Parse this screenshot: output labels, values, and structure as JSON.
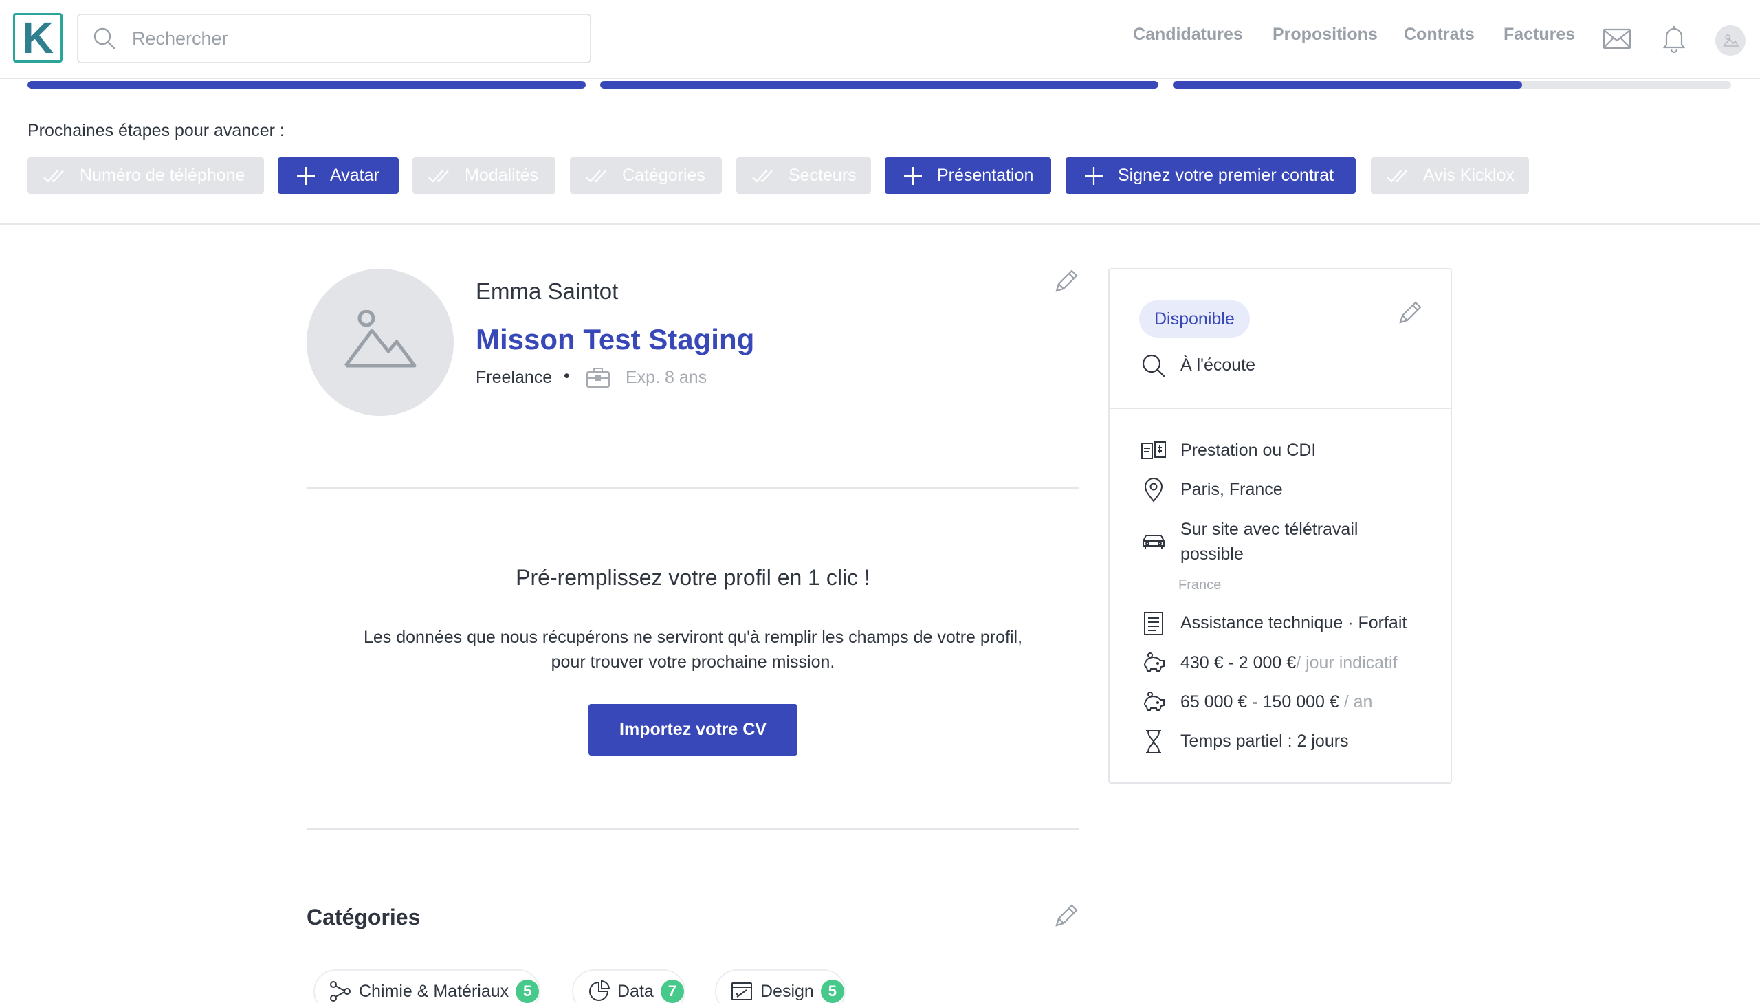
{
  "header": {
    "logo_letter": "K",
    "search_placeholder": "Rechercher",
    "nav": [
      "Candidatures",
      "Propositions",
      "Contrats",
      "Factures"
    ],
    "icons": [
      "envelope-icon",
      "bell-icon",
      "avatar-icon"
    ]
  },
  "progress": [
    1.0,
    1.0,
    0.625
  ],
  "steps": {
    "title": "Prochaines étapes pour avancer :",
    "items": [
      {
        "label": "Numéro de téléphone",
        "state": "done"
      },
      {
        "label": "Avatar",
        "state": "todo"
      },
      {
        "label": "Modalités",
        "state": "done"
      },
      {
        "label": "Catégories",
        "state": "done"
      },
      {
        "label": "Secteurs",
        "state": "done"
      },
      {
        "label": "Présentation",
        "state": "todo"
      },
      {
        "label": "Signez votre premier contrat",
        "state": "todo"
      },
      {
        "label": "Avis Kicklox",
        "state": "done"
      }
    ]
  },
  "profile": {
    "name": "Emma Saintot",
    "headline": "Misson Test Staging",
    "status": "Freelance",
    "separator": "•",
    "experience": "Exp. 8 ans"
  },
  "import": {
    "title": "Pré-remplissez votre profil en 1 clic !",
    "text_line1": "Les données que nous récupérons ne serviront qu'à remplir les champs de votre profil,",
    "text_line2": "pour trouver votre prochaine mission.",
    "button": "Importez votre CV"
  },
  "categories": {
    "title": "Catégories",
    "items": [
      {
        "label": "Chimie & Matériaux",
        "count": "5"
      },
      {
        "label": "Data",
        "count": "7"
      },
      {
        "label": "Design",
        "count": "5"
      }
    ]
  },
  "card": {
    "badge": "Disponible",
    "listening": "À l'écoute",
    "contract": "Prestation ou CDI",
    "location": "Paris, France",
    "remote_line1": "Sur site avec télétravail",
    "remote_line2": "possible",
    "remote_country": "France",
    "mission": "Assistance technique · Forfait",
    "daily_rate": "430 € - 2 000 €",
    "daily_unit": "/ jour indicatif",
    "salary": "65 000 € - 150 000 €",
    "salary_unit": " / an",
    "time": "Temps partiel : 2 jours"
  },
  "colors": {
    "primary": "#3848b8",
    "muted_chip": "#e3e4e7",
    "badge_bg": "#e8ebfa",
    "count_green": "#46c98a",
    "logo_teal": "#2aa59a"
  }
}
